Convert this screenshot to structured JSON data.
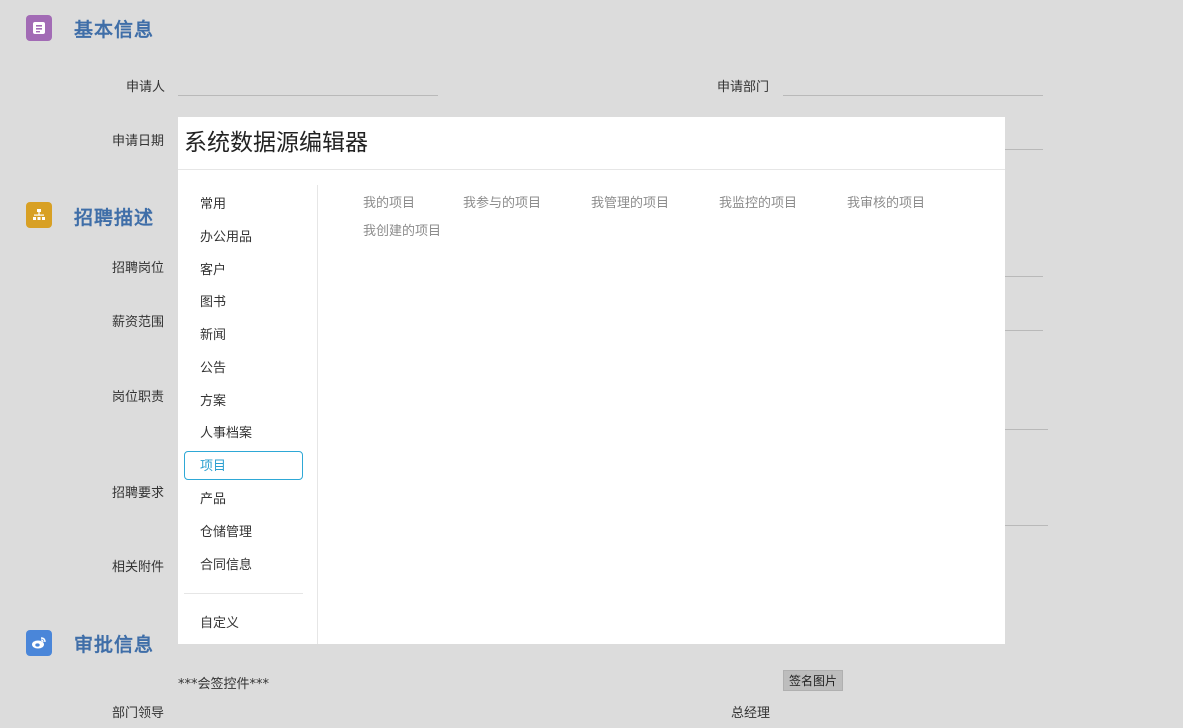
{
  "form": {
    "sections": {
      "basic": {
        "title": "基本信息",
        "icon": "form-icon",
        "color": "#a26bb5"
      },
      "recruit": {
        "title": "招聘描述",
        "icon": "org-chart-icon",
        "color": "#d8a024"
      },
      "approval": {
        "title": "审批信息",
        "icon": "weibo-icon",
        "color": "#4a86d9"
      }
    },
    "labels": {
      "applicant": "申请人",
      "dept": "申请部门",
      "date": "申请日期",
      "position": "招聘岗位",
      "salary": "薪资范围",
      "duty": "岗位职责",
      "requirement": "招聘要求",
      "attachment": "相关附件",
      "countersign": "***会签控件***",
      "dept_leader": "部门领导",
      "gm": "总经理"
    },
    "signature_button": "签名图片"
  },
  "modal": {
    "title": "系统数据源编辑器",
    "nav_items": [
      "常用",
      "办公用品",
      "客户",
      "图书",
      "新闻",
      "公告",
      "方案",
      "人事档案",
      "项目",
      "产品",
      "仓储管理",
      "合同信息"
    ],
    "active_item": "项目",
    "custom_item": "自定义",
    "datasources": [
      "我的项目",
      "我参与的项目",
      "我管理的项目",
      "我监控的项目",
      "我审核的项目",
      "我创建的项目"
    ],
    "colors": {
      "active_border": "#2ea8d6",
      "link": "#8c8c8c"
    }
  }
}
